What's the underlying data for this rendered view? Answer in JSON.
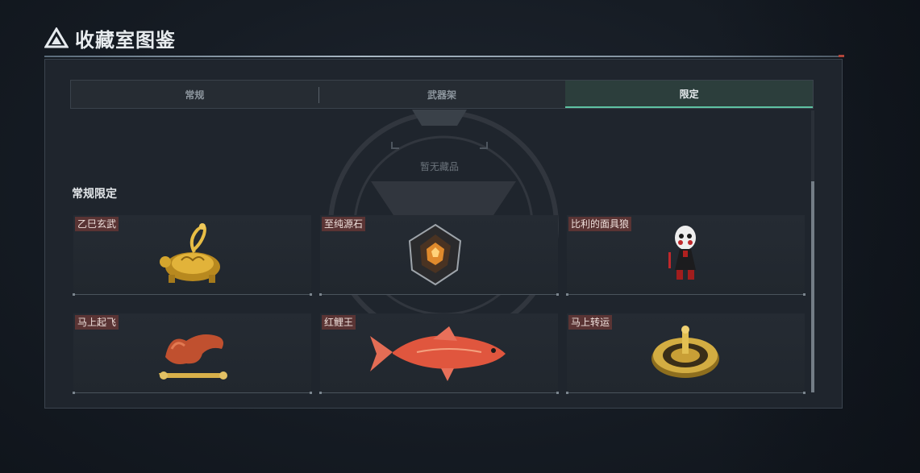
{
  "header": {
    "title": "收藏室图鉴"
  },
  "tabs": [
    {
      "label": "常规",
      "active": false
    },
    {
      "label": "武器架",
      "active": false
    },
    {
      "label": "限定",
      "active": true
    }
  ],
  "empty_state": {
    "text": "暂无藏品"
  },
  "section": {
    "title": "常规限定",
    "items": [
      {
        "label": "乙巳玄武",
        "icon": "golden-turtle-snake-icon"
      },
      {
        "label": "至纯源石",
        "icon": "source-stone-icon"
      },
      {
        "label": "比利的面具狼",
        "icon": "billy-puppet-icon"
      },
      {
        "label": "马上起飞",
        "icon": "golden-horse-icon"
      },
      {
        "label": "红鲤王",
        "icon": "red-carp-icon"
      },
      {
        "label": "马上转运",
        "icon": "golden-compass-wheel-icon"
      }
    ]
  },
  "colors": {
    "accent": "#5ec2a3",
    "label_bg": "#5a3434",
    "panel_bg": "#1f252d"
  }
}
